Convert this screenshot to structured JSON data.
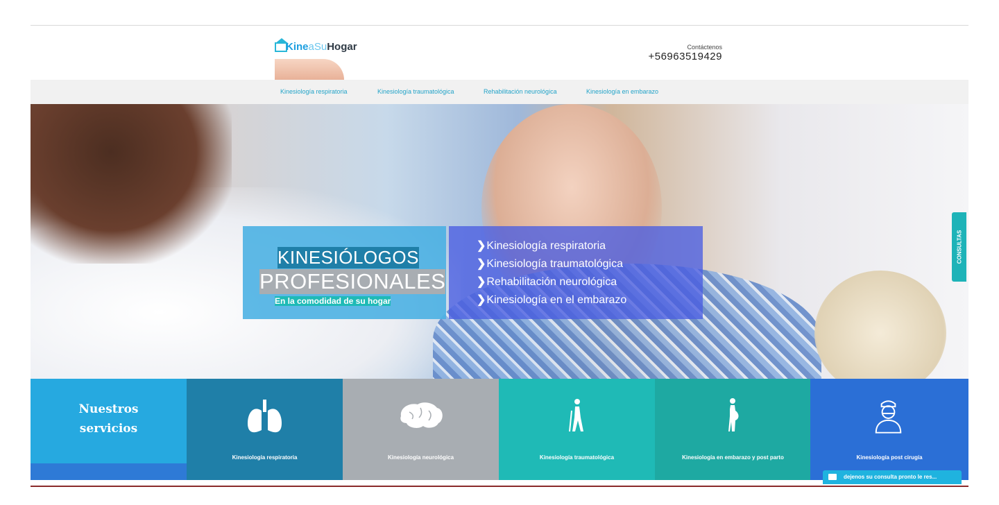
{
  "header": {
    "logo": {
      "part1": "Kine",
      "part2": "aSu",
      "part3": "Hogar"
    },
    "contact_label": "Contáctenos",
    "phone": "+56963519429"
  },
  "nav": [
    "Kinesiología respiratoria",
    "Kinesiología traumatológica",
    "Rehabilitación neurológica",
    "Kinesiología en embarazo"
  ],
  "hero": {
    "title_line1": "KINESIÓLOGOS",
    "title_line2": "PROFESIONALES",
    "subtitle": "En la comodidad de su hogar",
    "services": [
      "Kinesiología respiratoria",
      "Kinesiología traumatológica",
      "Rehabilitación neurológica",
      "Kinesiología en el embarazo"
    ]
  },
  "tiles": {
    "heading_line1": "Nuestros",
    "heading_line2": "servicios",
    "items": [
      {
        "label": "Kinesiología respiratoria",
        "icon": "lungs-icon"
      },
      {
        "label": "Kinesiología neurológica",
        "icon": "brain-icon"
      },
      {
        "label": "Kinesiología traumatológica",
        "icon": "walking-crutch-icon"
      },
      {
        "label": "Kinesiología en embarazo y post parto",
        "icon": "pregnant-icon"
      },
      {
        "label": "Kinesiología post cirugía",
        "icon": "surgeon-icon"
      }
    ]
  },
  "side_tab": "CONSULTAS",
  "chat": "dejenos su consulta pronto le res...",
  "colors": {
    "accent": "#26a9e0",
    "nav_text": "#22a3c8",
    "tile_respiratoria": "#1f7fa8",
    "tile_neurologica": "#a8adb2",
    "tile_traumatologica": "#1fbab6",
    "tile_embarazo": "#1ea9a2",
    "tile_cirugia": "#2b6fd6"
  }
}
